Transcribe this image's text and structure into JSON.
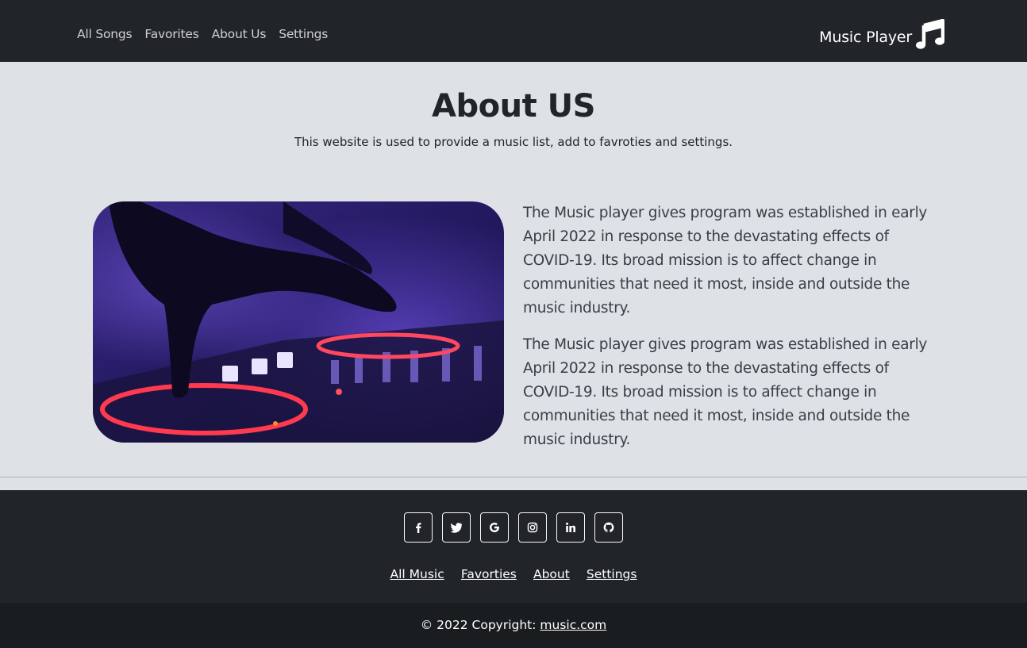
{
  "nav": {
    "links": [
      "All Songs",
      "Favorites",
      "About Us",
      "Settings"
    ],
    "brand": "Music Player",
    "brand_icon": "music-note-icon"
  },
  "about": {
    "title": "About US",
    "subtitle": "This website is used to provide a music list, add to favroties and settings.",
    "paragraphs": [
      "The Music player gives program was established in early April 2022 in response to the devastating effects of COVID-19. Its broad mission is to affect change in communities that need it most, inside and outside the music industry.",
      "The Music player gives program was established in early April 2022 in response to the devastating effects of COVID-19. Its broad mission is to affect change in communities that need it most, inside and outside the music industry."
    ]
  },
  "footer": {
    "social": [
      "facebook-icon",
      "twitter-icon",
      "google-icon",
      "instagram-icon",
      "linkedin-icon",
      "github-icon"
    ],
    "links": [
      "All Music",
      "Favorties",
      "About",
      "Settings"
    ],
    "copyright_prefix": "© 2022 Copyright: ",
    "copyright_link": "music.com"
  },
  "colors": {
    "navbar": "#212529",
    "page_bg": "#dee1e6",
    "copyright_bg": "#1a1d20"
  }
}
